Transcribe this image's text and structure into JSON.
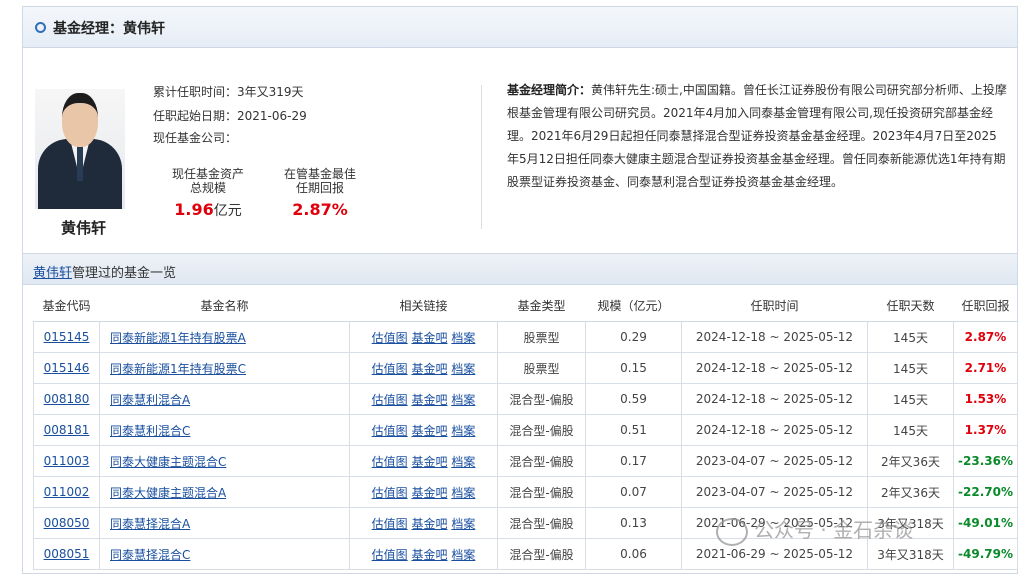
{
  "header": {
    "title": "基金经理：黄伟轩"
  },
  "manager": {
    "name": "黄伟轩",
    "tenure": "累计任职时间：3年又319天",
    "start_date": "任职起始日期：2021-06-29",
    "current_company": "现任基金公司：",
    "aum_label_1": "现任基金资产",
    "aum_label_2": "总规模",
    "aum_value": "1.96",
    "aum_unit": "亿元",
    "best_label_1": "在管基金最佳",
    "best_label_2": "任期回报",
    "best_value": "2.87%"
  },
  "bio": {
    "label": "基金经理简介：",
    "text": "黄伟轩先生:硕士,中国国籍。曾任长江证券股份有限公司研究部分析师、上投摩根基金管理有限公司研究员。2021年4月加入同泰基金管理有限公司,现任投资研究部基金经理。2021年6月29日起担任同泰慧择混合型证券投资基金基金经理。2023年4月7日至2025年5月12日担任同泰大健康主题混合型证券投资基金基金经理。曾任同泰新能源优选1年持有期股票型证券投资基金、同泰慧利混合型证券投资基金基金经理。"
  },
  "section": {
    "manager_link": "黄伟轩",
    "title_suffix": "管理过的基金一览"
  },
  "table": {
    "headers": [
      "基金代码",
      "基金名称",
      "相关链接",
      "基金类型",
      "规模（亿元）",
      "任职时间",
      "任职天数",
      "任职回报"
    ],
    "link_labels": [
      "估值图",
      "基金吧",
      "档案"
    ],
    "rows": [
      {
        "code": "015145",
        "name": "同泰新能源1年持有股票A",
        "type": "股票型",
        "size": "0.29",
        "period": "2024-12-18 ~ 2025-05-12",
        "days": "145天",
        "ret": "2.87%"
      },
      {
        "code": "015146",
        "name": "同泰新能源1年持有股票C",
        "type": "股票型",
        "size": "0.15",
        "period": "2024-12-18 ~ 2025-05-12",
        "days": "145天",
        "ret": "2.71%"
      },
      {
        "code": "008180",
        "name": "同泰慧利混合A",
        "type": "混合型-偏股",
        "size": "0.59",
        "period": "2024-12-18 ~ 2025-05-12",
        "days": "145天",
        "ret": "1.53%"
      },
      {
        "code": "008181",
        "name": "同泰慧利混合C",
        "type": "混合型-偏股",
        "size": "0.51",
        "period": "2024-12-18 ~ 2025-05-12",
        "days": "145天",
        "ret": "1.37%"
      },
      {
        "code": "011003",
        "name": "同泰大健康主题混合C",
        "type": "混合型-偏股",
        "size": "0.17",
        "period": "2023-04-07 ~ 2025-05-12",
        "days": "2年又36天",
        "ret": "-23.36%"
      },
      {
        "code": "011002",
        "name": "同泰大健康主题混合A",
        "type": "混合型-偏股",
        "size": "0.07",
        "period": "2023-04-07 ~ 2025-05-12",
        "days": "2年又36天",
        "ret": "-22.70%"
      },
      {
        "code": "008050",
        "name": "同泰慧择混合A",
        "type": "混合型-偏股",
        "size": "0.13",
        "period": "2021-06-29 ~ 2025-05-12",
        "days": "3年又318天",
        "ret": "-49.01%"
      },
      {
        "code": "008051",
        "name": "同泰慧择混合C",
        "type": "混合型-偏股",
        "size": "0.06",
        "period": "2021-06-29 ~ 2025-05-12",
        "days": "3年又318天",
        "ret": "-49.79%"
      }
    ]
  },
  "watermark": {
    "text": "公众号 · 金石杂谈"
  },
  "colors": {
    "positive": "#e0000c",
    "negative": "#0a8a2a",
    "link": "#1a4fa0"
  }
}
